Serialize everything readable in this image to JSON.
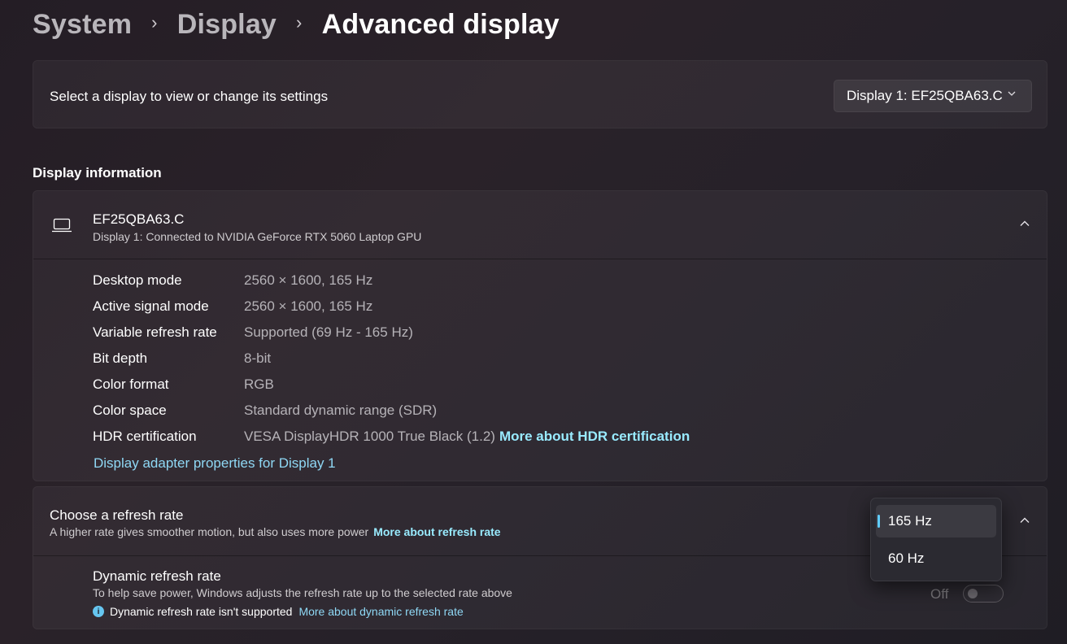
{
  "breadcrumb": {
    "items": [
      "System",
      "Display"
    ],
    "current": "Advanced display"
  },
  "display_select": {
    "label": "Select a display to view or change its settings",
    "value": "Display 1: EF25QBA63.C"
  },
  "display_information": {
    "section_title": "Display information",
    "monitor_name": "EF25QBA63.C",
    "monitor_subtitle": "Display 1: Connected to NVIDIA GeForce RTX 5060 Laptop GPU",
    "rows": [
      {
        "label": "Desktop mode",
        "value": "2560 × 1600, 165 Hz"
      },
      {
        "label": "Active signal mode",
        "value": "2560 × 1600, 165 Hz"
      },
      {
        "label": "Variable refresh rate",
        "value": "Supported (69 Hz - 165 Hz)"
      },
      {
        "label": "Bit depth",
        "value": "8-bit"
      },
      {
        "label": "Color format",
        "value": "RGB"
      },
      {
        "label": "Color space",
        "value": "Standard dynamic range (SDR)"
      },
      {
        "label": "HDR certification",
        "value": "VESA DisplayHDR 1000 True Black (1.2)",
        "link": "More about HDR certification"
      }
    ],
    "adapter_link": "Display adapter properties for Display 1"
  },
  "refresh_rate": {
    "title": "Choose a refresh rate",
    "subtitle": "A higher rate gives smoother motion, but also uses more power",
    "link": "More about refresh rate",
    "options": [
      "165 Hz",
      "60 Hz"
    ],
    "selected": "165 Hz"
  },
  "dynamic_refresh": {
    "title": "Dynamic refresh rate",
    "subtitle": "To help save power, Windows adjusts the refresh rate up to the selected rate above",
    "warning": "Dynamic refresh rate isn't supported",
    "warning_icon": "i",
    "link": "More about dynamic refresh rate",
    "toggle_state": "Off"
  },
  "colors": {
    "accent": "#60cdff",
    "link": "#99ebff"
  }
}
